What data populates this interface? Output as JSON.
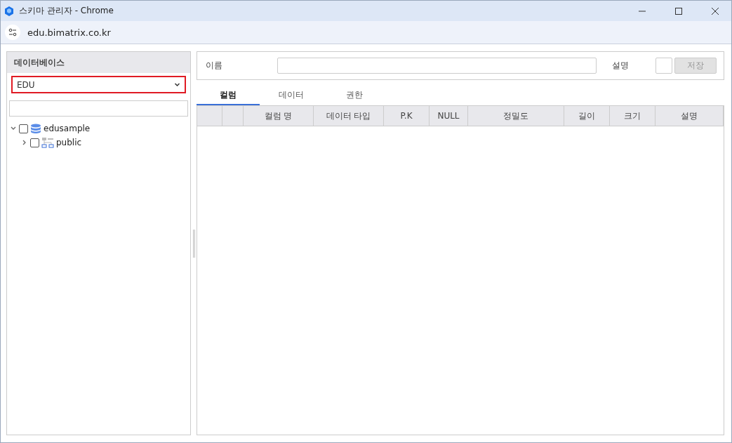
{
  "window": {
    "title": "스키마 관리자 - Chrome"
  },
  "address_bar": {
    "url": "edu.bimatrix.co.kr"
  },
  "sidebar": {
    "title": "데이터베이스",
    "database_select": {
      "value": "EDU"
    },
    "tree": [
      {
        "label": "edusample",
        "kind": "database",
        "expanded": true,
        "checked": false,
        "children": [
          {
            "label": "public",
            "kind": "schema",
            "expanded": false,
            "checked": false
          }
        ]
      }
    ]
  },
  "form": {
    "name_label": "이름",
    "description_label": "설명",
    "save_button": {
      "label": "저장",
      "disabled": true
    }
  },
  "tabs": [
    {
      "label": "컬럼",
      "selected": true
    },
    {
      "label": "데이터",
      "selected": false
    },
    {
      "label": "권한",
      "selected": false
    }
  ],
  "table": {
    "columns": [
      "컬럼 명",
      "데이터 타입",
      "P.K",
      "NULL",
      "정밀도",
      "길이",
      "크기",
      "설명"
    ]
  }
}
